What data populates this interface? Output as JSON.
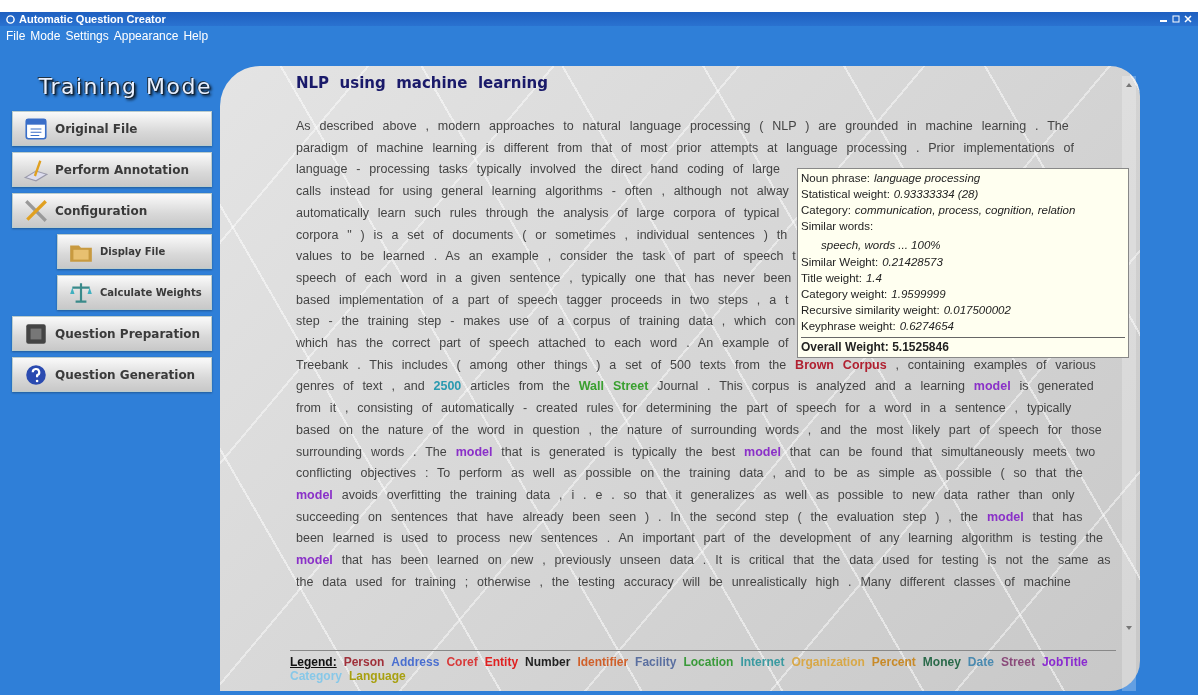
{
  "window": {
    "title": "Automatic Question Creator"
  },
  "menu": [
    "File",
    "Mode",
    "Settings",
    "Appearance",
    "Help"
  ],
  "sidebar": {
    "heading": "Training Mode",
    "items": [
      {
        "label": "Original File",
        "kind": "main"
      },
      {
        "label": "Perform Annotation",
        "kind": "main"
      },
      {
        "label": "Configuration",
        "kind": "main"
      },
      {
        "label": "Display File",
        "kind": "sub"
      },
      {
        "label": "Calculate Weights",
        "kind": "sub"
      },
      {
        "label": "Question Preparation",
        "kind": "main"
      },
      {
        "label": "Question Generation",
        "kind": "main"
      }
    ]
  },
  "document": {
    "title": "NLP  using  machine  learning",
    "lines": [
      [
        {
          "text": "As described above , modern approaches to natural language processing ( NLP ) are grounded in machine learning . The"
        }
      ],
      [
        {
          "text": "paradigm of machine learning is different from that of most prior attempts at language processing . Prior implementations of"
        }
      ],
      [
        {
          "text": "language - processing tasks typically involved the direct hand coding of large"
        }
      ],
      [
        {
          "text": "calls instead for using general learning algorithms - often , although not alway"
        }
      ],
      [
        {
          "text": "automatically learn such rules through the analysis of large corpora of typical"
        }
      ],
      [
        {
          "text": "corpora \" ) is a set of documents ( or sometimes , individual sentences ) th"
        }
      ],
      [
        {
          "text": "values to be learned . As an example , consider the task of part of speech t"
        }
      ],
      [
        {
          "text": "speech of each word in a given sentence , typically one that has never been"
        }
      ],
      [
        {
          "text": "based implementation of a part of speech tagger proceeds in two steps , a t"
        }
      ],
      [
        {
          "text": "step - the training step - makes use of a corpus of training data , which con"
        }
      ],
      [
        {
          "text": "which has the correct part of speech attached to each word . An example of"
        }
      ],
      [
        {
          "text": "Treebank . This includes ( among other things ) a set of 500 texts from the "
        },
        {
          "text": "Brown Corpus",
          "color": "#b02030"
        },
        {
          "text": " , containing examples of various"
        }
      ],
      [
        {
          "text": "genres of text , and "
        },
        {
          "text": "2500",
          "color": "#2a9ab0"
        },
        {
          "text": " articles from the "
        },
        {
          "text": "Wall Street",
          "color": "#3aa030"
        },
        {
          "text": " Journal . This corpus is analyzed and a learning "
        },
        {
          "text": "model",
          "color": "#8a30c8"
        },
        {
          "text": " is generated"
        }
      ],
      [
        {
          "text": "from it , consisting of automatically - created rules for determining the part of speech for a word in a sentence , typically"
        }
      ],
      [
        {
          "text": "based on the nature of the word in question , the nature of surrounding words , and the most likely part of speech for those"
        }
      ],
      [
        {
          "text": "surrounding words . The "
        },
        {
          "text": "model",
          "color": "#8a30c8"
        },
        {
          "text": " that is generated is typically the best "
        },
        {
          "text": "model",
          "color": "#8a30c8"
        },
        {
          "text": " that can be found that simultaneously meets two"
        }
      ],
      [
        {
          "text": "conflicting objectives : To perform as well as possible on the training data , and to be as simple as possible ( so that the"
        }
      ],
      [
        {
          "text": "model",
          "color": "#8a30c8"
        },
        {
          "text": " avoids overfitting the training data , i . e . so that it generalizes as well as possible to new data rather than only"
        }
      ],
      [
        {
          "text": "succeeding on sentences that have already been seen ) . In the second step ( the evaluation step ) , the "
        },
        {
          "text": "model",
          "color": "#8a30c8"
        },
        {
          "text": " that has"
        }
      ],
      [
        {
          "text": "been learned is used to process new sentences . An important part of the development of any learning algorithm is testing the"
        }
      ],
      [
        {
          "text": "model",
          "color": "#8a30c8"
        },
        {
          "text": " that has been learned on new , previously unseen data . It is critical that the data used for testing is not the same as"
        }
      ],
      [
        {
          "text": "the data used for training ; otherwise , the testing accuracy will be unrealistically high . Many different classes of machine"
        }
      ]
    ]
  },
  "tooltip": {
    "rows": [
      {
        "label": "Noun phrase:",
        "value": "language processing"
      },
      {
        "label": "Statistical weight:",
        "value": "0.93333334 (28)"
      },
      {
        "label": "Category:",
        "value": "communication, process, cognition, relation"
      },
      {
        "label": "Similar words:",
        "value": ""
      },
      {
        "label": "",
        "value": "speech, words ... 100%"
      },
      {
        "label": "Similar Weight:",
        "value": "0.21428573"
      },
      {
        "label": "Title weight:",
        "value": "1.4"
      },
      {
        "label": "Category weight:",
        "value": "1.9599999"
      },
      {
        "label": "Recursive similarity weight:",
        "value": "0.017500002"
      },
      {
        "label": "Keyphrase weight:",
        "value": "0.6274654"
      }
    ],
    "total": "Overall Weight: 5.1525846"
  },
  "legend": {
    "title": "Legend:",
    "items": [
      {
        "label": "Person",
        "color": "#a0303a"
      },
      {
        "label": "Address",
        "color": "#4a6fd0"
      },
      {
        "label": "Coref",
        "color": "#d83a3a"
      },
      {
        "label": "Entity",
        "color": "#e02020"
      },
      {
        "label": "Number",
        "color": "#222222"
      },
      {
        "label": "Identifier",
        "color": "#d0602a"
      },
      {
        "label": "Facility",
        "color": "#5a6fa0"
      },
      {
        "label": "Location",
        "color": "#3a9a3a"
      },
      {
        "label": "Internet",
        "color": "#3a9aa0"
      },
      {
        "label": "Organization",
        "color": "#d8a848"
      },
      {
        "label": "Percent",
        "color": "#c88a28"
      },
      {
        "label": "Money",
        "color": "#2a6a4a"
      },
      {
        "label": "Date",
        "color": "#4a8ab0"
      },
      {
        "label": "Street",
        "color": "#8a4a7a"
      },
      {
        "label": "JobTitle",
        "color": "#8a2ad0"
      },
      {
        "label": "Category",
        "color": "#88c8e8"
      },
      {
        "label": "Language",
        "color": "#a8a010"
      }
    ]
  }
}
